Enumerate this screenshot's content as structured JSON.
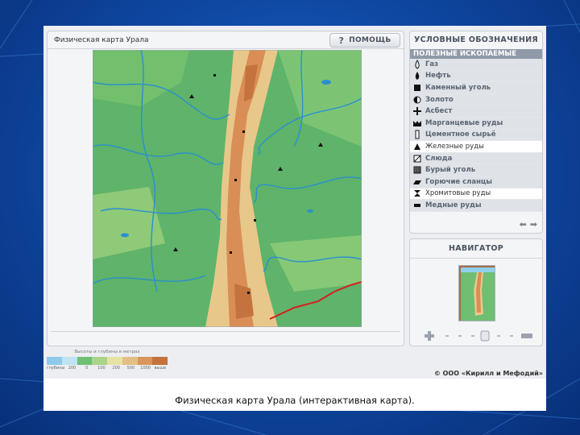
{
  "map": {
    "title": "Физическая карта Урала",
    "help_label": "ПОМОЩЬ",
    "help_icon": "question-icon"
  },
  "legend": {
    "title": "УСЛОВНЫЕ ОБОЗНАЧЕНИЯ",
    "subtitle": "ПОЛЕЗНЫЕ ИСКОПАЕМЫЕ",
    "items": [
      {
        "label": "Газ",
        "icon": "gas-icon",
        "highlighted": false
      },
      {
        "label": "Нефть",
        "icon": "oil-icon",
        "highlighted": false
      },
      {
        "label": "Каменный уголь",
        "icon": "coal-icon",
        "highlighted": false
      },
      {
        "label": "Золото",
        "icon": "gold-icon",
        "highlighted": false
      },
      {
        "label": "Асбест",
        "icon": "asbestos-icon",
        "highlighted": false
      },
      {
        "label": "Марганцевые руды",
        "icon": "manganese-icon",
        "highlighted": false
      },
      {
        "label": "Цементное сырьё",
        "icon": "cement-icon",
        "highlighted": false
      },
      {
        "label": "Железные руды",
        "icon": "iron-icon",
        "highlighted": true
      },
      {
        "label": "Слюда",
        "icon": "mica-icon",
        "highlighted": false
      },
      {
        "label": "Бурый уголь",
        "icon": "brown-coal-icon",
        "highlighted": false
      },
      {
        "label": "Горючие сланцы",
        "icon": "shale-icon",
        "highlighted": false
      },
      {
        "label": "Хромитовые руды",
        "icon": "chromite-icon",
        "highlighted": true
      },
      {
        "label": "Медные руды",
        "icon": "copper-icon",
        "highlighted": false
      }
    ]
  },
  "navigator": {
    "title": "НАВИГАТОР"
  },
  "scale": {
    "caption": "Высоты и глубины в метрах",
    "labels": [
      "глубины",
      "200",
      "0",
      "100",
      "200",
      "500",
      "1000",
      "выше"
    ],
    "colors": [
      "#8fc9ec",
      "#bfe3f3",
      "#6fbf73",
      "#a9d48a",
      "#e8e2a4",
      "#e3bf86",
      "#d9955b",
      "#c4733c"
    ]
  },
  "copyright": "© ООО «Кирилл и Мефодий»",
  "caption": "Физическая карта Урала (интерактивная карта).",
  "colors": {
    "lowland": "#5fb36a",
    "highland": "#e8c88a",
    "mountain": "#d98e56",
    "river": "#2a8fd0",
    "border": "#d42020"
  }
}
